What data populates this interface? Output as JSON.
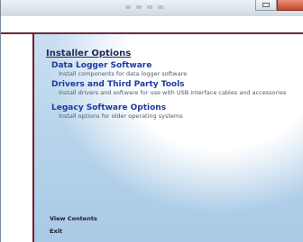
{
  "window": {
    "controls": [
      "restore",
      "close"
    ]
  },
  "page": {
    "title": "Installer Options"
  },
  "options": [
    {
      "title": "Data Logger Software",
      "description": "Install components for data logger software"
    },
    {
      "title": "Drivers and Third Party Tools",
      "description": "Install drivers and software for use with USB interface cables and accessories"
    },
    {
      "title": "Legacy Software Options",
      "description": "Install options for older operating systems"
    }
  ],
  "footer": {
    "view_contents": "View Contents",
    "exit": "Exit"
  },
  "colors": {
    "accent_rule": "#7a1c2a",
    "link_blue": "#1c3aa0",
    "background_blue": "#b5d2ea"
  }
}
